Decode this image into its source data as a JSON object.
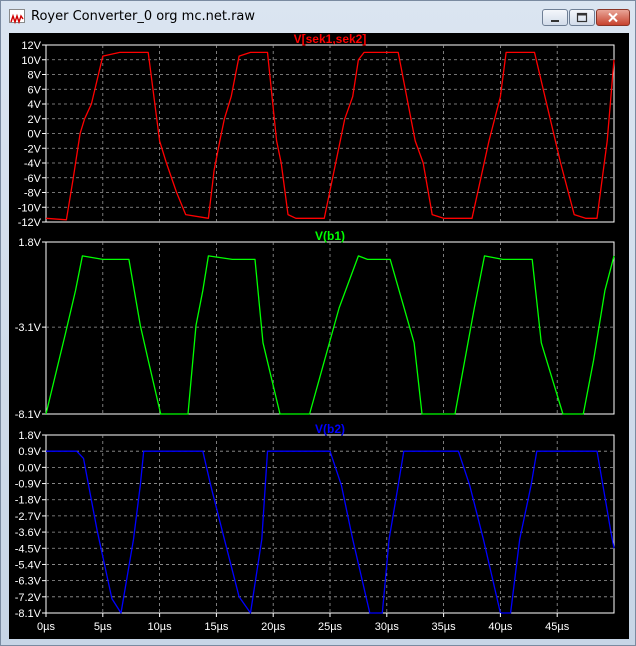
{
  "window": {
    "title": "Royer Converter_0 org mc.net.raw",
    "icons": {
      "app": "waveform-app-icon",
      "minimize": "minimize-icon",
      "maximize": "maximize-icon",
      "close": "close-icon"
    }
  },
  "chart_data": [
    {
      "type": "line",
      "title": "V[sek1,sek2]",
      "color": "#ff0000",
      "yunit": "V",
      "ylim": [
        -12,
        12
      ],
      "yticks": [
        "12V",
        "10V",
        "8V",
        "6V",
        "4V",
        "2V",
        "0V",
        "-2V",
        "-4V",
        "-6V",
        "-8V",
        "-10V",
        "-12V"
      ],
      "grid": true,
      "series": [
        {
          "x": [
            0,
            1.8,
            2.4,
            3,
            3.4,
            4,
            5,
            6.5,
            8,
            9,
            9.5,
            10,
            10.6,
            11.5,
            12.3,
            14.3,
            14.8,
            15.3,
            15.7,
            16.3,
            17,
            18,
            19.5,
            20.3,
            20.7,
            21.3,
            22,
            23,
            24.5,
            26.3,
            27,
            27.5,
            28,
            29,
            31,
            32.5,
            33.2,
            34,
            35,
            36,
            37.5,
            39,
            39.5,
            40,
            40.5,
            41.5,
            43,
            45.3,
            46.5,
            47.5,
            48.5,
            49.4,
            50
          ],
          "y": [
            -11.5,
            -11.7,
            -6,
            0,
            2,
            4,
            10.5,
            11,
            11,
            11,
            5,
            -1,
            -4,
            -8,
            -11,
            -11.5,
            -5,
            -1,
            2,
            5,
            10.5,
            11,
            11,
            -1,
            -4,
            -11,
            -11.5,
            -11.5,
            -11.5,
            2,
            5,
            10,
            11,
            11,
            11,
            -1,
            -4,
            -11,
            -11.5,
            -11.5,
            -11.5,
            -1,
            2,
            5,
            11,
            11,
            11,
            -4,
            -11,
            -11.5,
            -11.5,
            -1,
            10
          ]
        }
      ]
    },
    {
      "type": "line",
      "title": "V(b1)",
      "color": "#00ff00",
      "yunit": "V",
      "ylim": [
        -8.1,
        1.8
      ],
      "yticks": [
        "1.8V",
        "-3.1V",
        "-8.1V"
      ],
      "grid": true,
      "series": [
        {
          "x": [
            0,
            1.7,
            2.6,
            3.2,
            5,
            7.3,
            8.3,
            9,
            10.1,
            12.5,
            13.2,
            13.8,
            14.3,
            16.4,
            18.4,
            19.1,
            20.6,
            22,
            23.2,
            25.8,
            27.5,
            28.3,
            30.3,
            32.4,
            33.1,
            34.2,
            36,
            37.7,
            38.6,
            40.2,
            42.8,
            43.6,
            45.5,
            47.3,
            48.2,
            49.2,
            50
          ],
          "y": [
            -8.1,
            -3.5,
            -1,
            1,
            0.8,
            0.8,
            -3,
            -5,
            -8.1,
            -8.1,
            -3,
            -1,
            1,
            0.8,
            0.8,
            -4,
            -8.1,
            -8.1,
            -8.1,
            -2,
            1,
            0.8,
            0.8,
            -4,
            -8.1,
            -8.1,
            -8.1,
            -2,
            1,
            0.8,
            0.8,
            -4,
            -8.1,
            -8.1,
            -5,
            -1,
            1
          ]
        }
      ]
    },
    {
      "type": "line",
      "title": "V(b2)",
      "color": "#0000ff",
      "yunit": "V",
      "ylim": [
        -8.1,
        1.8
      ],
      "yticks": [
        "1.8V",
        "0.9V",
        "0.0V",
        "-0.9V",
        "-1.8V",
        "-2.7V",
        "-3.6V",
        "-4.5V",
        "-5.4V",
        "-6.3V",
        "-7.2V",
        "-8.1V"
      ],
      "grid": true,
      "series": [
        {
          "x": [
            0,
            2.7,
            3.3,
            4.5,
            5.8,
            6.6,
            7.7,
            8.3,
            8.6,
            13.8,
            14.5,
            15.7,
            17,
            18,
            19,
            19.5,
            25,
            26,
            27,
            28.5,
            29.6,
            30.2,
            31,
            31.5,
            36.3,
            37.3,
            38.5,
            40,
            40.9,
            41.7,
            42.7,
            43.2,
            48.5,
            49.3,
            49.7,
            50
          ],
          "y": [
            0.9,
            0.9,
            0.5,
            -3.5,
            -7.3,
            -8.1,
            -4,
            -1,
            0.9,
            0.9,
            -1,
            -4,
            -7.2,
            -8.1,
            -4,
            0.9,
            0.9,
            -1,
            -4,
            -8.1,
            -8.1,
            -4,
            -1,
            0.9,
            0.9,
            -1,
            -4,
            -8.1,
            -8.1,
            -4,
            -1,
            0.9,
            0.9,
            -2,
            -3.5,
            -4.5
          ]
        }
      ]
    }
  ],
  "xaxis": {
    "xlim": [
      0,
      50
    ],
    "unit": "µs",
    "ticks": [
      "0µs",
      "5µs",
      "10µs",
      "15µs",
      "20µs",
      "25µs",
      "30µs",
      "35µs",
      "40µs",
      "45µs"
    ],
    "tick_values": [
      0,
      5,
      10,
      15,
      20,
      25,
      30,
      35,
      40,
      45
    ]
  }
}
